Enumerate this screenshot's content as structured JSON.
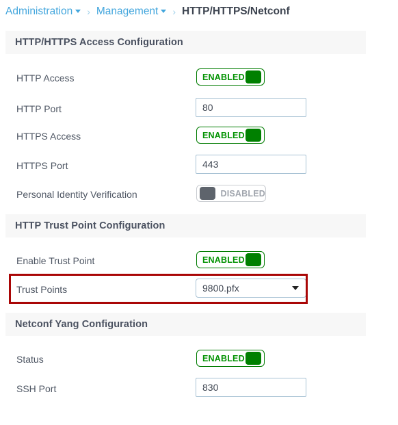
{
  "breadcrumb": {
    "items": [
      {
        "label": "Administration",
        "has_caret": true,
        "type": "link"
      },
      {
        "label": "Management",
        "has_caret": true,
        "type": "link"
      },
      {
        "label": "HTTP/HTTPS/Netconf",
        "has_caret": false,
        "type": "current"
      }
    ],
    "separator": "›"
  },
  "sections": {
    "http_access": {
      "title": "HTTP/HTTPS Access Configuration",
      "rows": {
        "http_access": {
          "label": "HTTP Access",
          "control": "toggle",
          "state": "ENABLED"
        },
        "http_port": {
          "label": "HTTP Port",
          "control": "input",
          "value": "80",
          "placeholder": ""
        },
        "https_access": {
          "label": "HTTPS Access",
          "control": "toggle",
          "state": "ENABLED"
        },
        "https_port": {
          "label": "HTTPS Port",
          "control": "input",
          "value": "443",
          "placeholder": ""
        },
        "piv": {
          "label": "Personal Identity Verification",
          "control": "toggle",
          "state": "DISABLED"
        }
      }
    },
    "trust_point": {
      "title": "HTTP Trust Point Configuration",
      "rows": {
        "enable_trust_point": {
          "label": "Enable Trust Point",
          "control": "toggle",
          "state": "ENABLED"
        },
        "trust_points": {
          "label": "Trust Points",
          "control": "select",
          "value": "9800.pfx",
          "highlighted": true
        }
      }
    },
    "netconf": {
      "title": "Netconf Yang Configuration",
      "rows": {
        "status": {
          "label": "Status",
          "control": "toggle",
          "state": "ENABLED"
        },
        "ssh_port": {
          "label": "SSH Port",
          "control": "input",
          "value": "830",
          "placeholder": ""
        }
      }
    }
  },
  "colors": {
    "link": "#43a6dd",
    "enabled_green": "#008000",
    "disabled_gray": "#5e646c",
    "highlight_red": "#a90606",
    "section_band": "#f7f7f7",
    "label_text": "#4f5764"
  },
  "icons": {
    "breadcrumb_caret": "caret-down-icon",
    "select_caret": "chevron-down-icon"
  }
}
